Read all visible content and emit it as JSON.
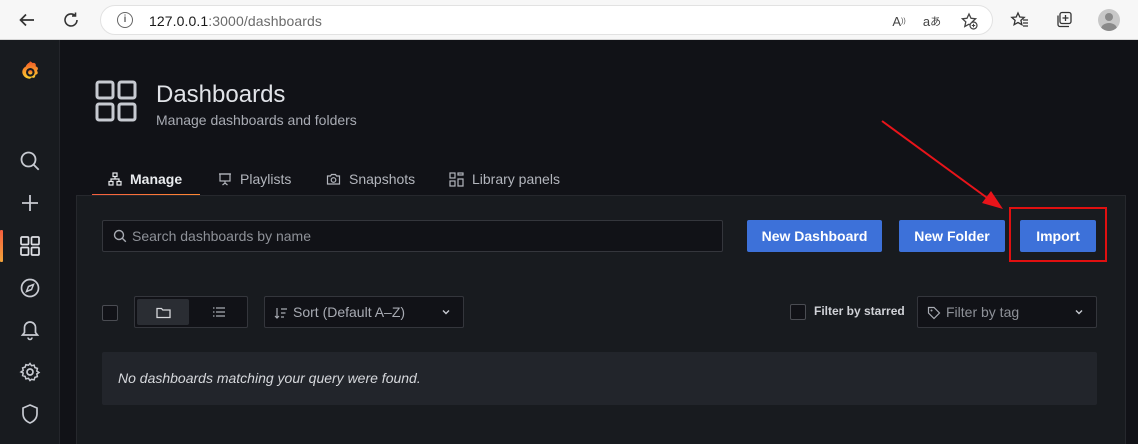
{
  "browser": {
    "url_host": "127.0.0.1",
    "url_rest": ":3000/dashboards",
    "icons": [
      "back-icon",
      "reload-icon",
      "info-icon",
      "read-aloud-icon",
      "translate-icon",
      "add-favorite-icon",
      "favorites-icon",
      "collections-icon",
      "profile-icon"
    ]
  },
  "sidebar": {
    "items": [
      {
        "name": "grafana-logo",
        "icon": "grafana-logo-icon"
      },
      {
        "name": "search",
        "icon": "search-icon"
      },
      {
        "name": "create",
        "icon": "plus-icon"
      },
      {
        "name": "dashboards",
        "icon": "dashboards-icon",
        "active": true
      },
      {
        "name": "explore",
        "icon": "compass-icon"
      },
      {
        "name": "alerting",
        "icon": "bell-icon"
      },
      {
        "name": "configuration",
        "icon": "gear-icon"
      },
      {
        "name": "server-admin",
        "icon": "shield-icon"
      }
    ]
  },
  "header": {
    "title": "Dashboards",
    "subtitle": "Manage dashboards and folders"
  },
  "tabs": [
    {
      "label": "Manage",
      "icon": "sitemap-icon",
      "active": true
    },
    {
      "label": "Playlists",
      "icon": "presentation-icon"
    },
    {
      "label": "Snapshots",
      "icon": "camera-icon"
    },
    {
      "label": "Library panels",
      "icon": "library-panels-icon"
    }
  ],
  "toolbar": {
    "search_placeholder": "Search dashboards by name",
    "new_dashboard_label": "New Dashboard",
    "new_folder_label": "New Folder",
    "import_label": "Import"
  },
  "filters": {
    "sort_label": "Sort (Default A–Z)",
    "starred_label": "Filter by starred",
    "tag_placeholder": "Filter by tag"
  },
  "results": {
    "empty_message": "No dashboards matching your query were found."
  },
  "colors": {
    "accent": "#3d71d9",
    "highlight": "#e01010",
    "tab_underline": "#f55f3e"
  }
}
